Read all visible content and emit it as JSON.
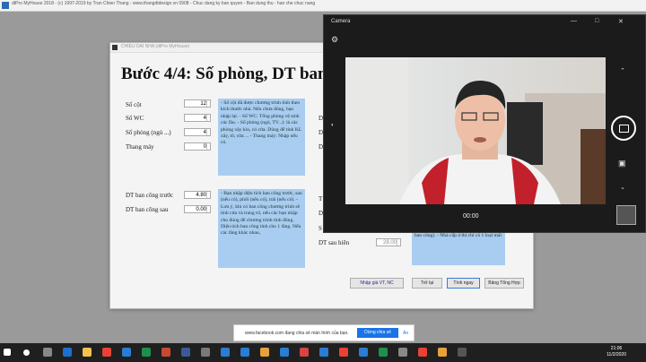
{
  "app": {
    "title": "dtPro MyHouse 2018 - (c) 1997-2019 by Tran Chien Thang - www.thangdtdesign.vn 0908 - Chuc dang ky ban quyen - Ban dung thu - han che chuc nang"
  },
  "dialog": {
    "bar_title": "CHIEU DAI NHA (dtPro MyHouse)",
    "heading": "Bước 4/4: Số phòng, DT ban",
    "fields": [
      {
        "label": "Số cột",
        "value": "12"
      },
      {
        "label": "Số WC",
        "value": "4"
      },
      {
        "label": "Số phòng (ngủ ...)",
        "value": "4"
      },
      {
        "label": "Thang máy",
        "value": "0"
      },
      {
        "label": "DT ban công trước",
        "value": "4.80"
      },
      {
        "label": "DT ban công sau",
        "value": "0.00"
      }
    ],
    "note1": "- Số cột đã được chương trình tính theo kích thước nhà. Nếu chưa đúng, bạn nhập lại. - Số WC: Tổng phòng vệ sinh các lầu. - Số phòng (ngủ, TV...): là các phòng xây kín, có cửa. Dùng để tính KL xây, tô, cửa ... - Thang máy: Nhập nếu có.",
    "note2": "- Bạn nhập diện tích ban công trước, sau (nếu có), phối (nếu có), trái (nếu có). - Lưu ý, khi có ban công chương trình sẽ tính cửa và trang trí, nếu các bạn nhập cho đúng để chương trình tính đúng. Diện tích ban công tính cho 1 tầng. Nếu các tầng khác nhau,",
    "right_labels": [
      "D",
      "D",
      "D",
      "T",
      "D",
      "S",
      "DT sau hiên"
    ],
    "right_value": "28.00",
    "note3": "ban công). - Nhà cấp 4 thì chỉ có 1 loại mái",
    "buttons": {
      "b1": "Nhập giá VT, NC",
      "b2": "Trở lại",
      "b3": "Tính ngay",
      "b4": "Bảng Tổng Hợp"
    }
  },
  "camera": {
    "title": "Camera",
    "time": "00:00"
  },
  "share": {
    "text": "www.facebook.com đang chia sẻ màn hình của bạn.",
    "stop": "Dừng chia sẻ",
    "hide": "Ẩn"
  },
  "taskbar": {
    "time": "21:06",
    "date": "11/2/2020"
  },
  "colors": {
    "note_bg": "#a8cdf0",
    "accent": "#1a73e8",
    "taskbar": "#1f1f1f"
  }
}
